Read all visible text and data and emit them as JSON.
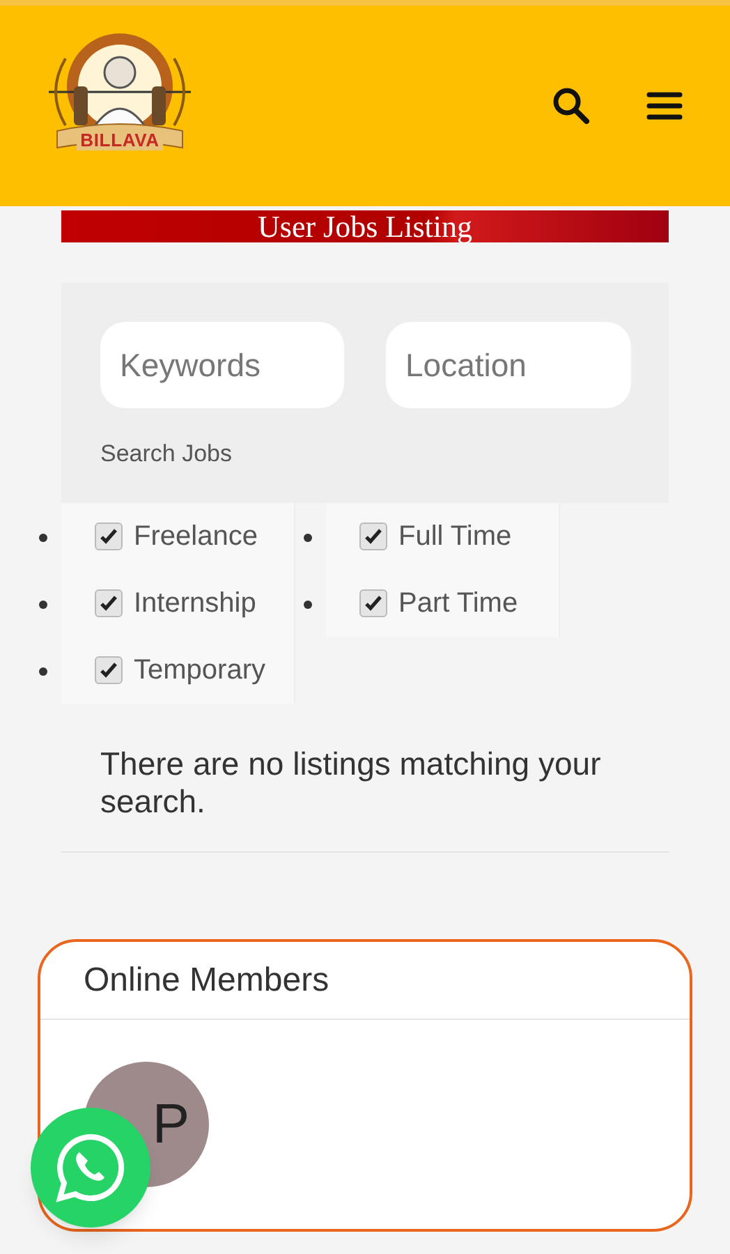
{
  "header": {
    "logo_text": "BILLAVA"
  },
  "banner": {
    "title": "User Jobs Listing"
  },
  "search": {
    "keywords": {
      "placeholder": "Keywords"
    },
    "location": {
      "placeholder": "Location"
    },
    "button": "Search Jobs"
  },
  "job_types": [
    {
      "label": "Freelance",
      "checked": true
    },
    {
      "label": "Full Time",
      "checked": true
    },
    {
      "label": "Internship",
      "checked": true
    },
    {
      "label": "Part Time",
      "checked": true
    },
    {
      "label": "Temporary",
      "checked": true
    }
  ],
  "message": "There are no listings matching your search.",
  "online_members": {
    "title": "Online Members",
    "members": [
      {
        "initials": "P",
        "color": "#9e8a8a"
      }
    ]
  }
}
